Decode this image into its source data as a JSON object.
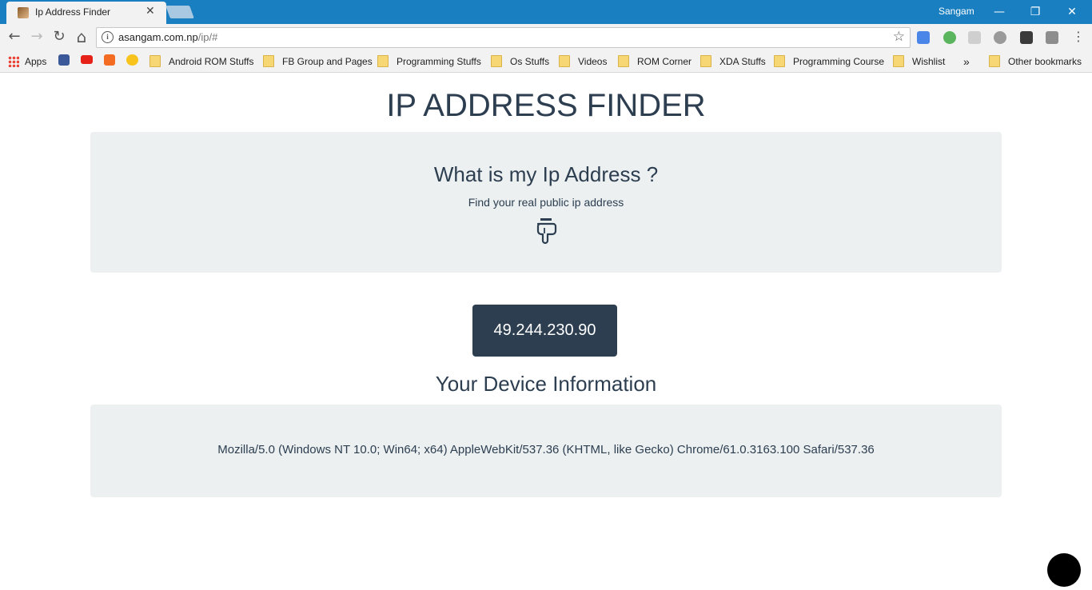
{
  "browser": {
    "tab_title": "Ip Address Finder",
    "tab_close": "✕",
    "profile_name": "Sangam",
    "window_controls": {
      "minimize": "—",
      "restore": "❐",
      "close": "✕"
    },
    "nav": {
      "back": "←",
      "forward": "→",
      "reload": "↻",
      "home": "⌂"
    },
    "url_host": "asangam.com.np",
    "url_path": "/ip/#",
    "bookmark_star": "☆",
    "bookmarks": {
      "apps": "Apps",
      "items": [
        "Android ROM Stuffs",
        "FB Group and Pages",
        "Programming Stuffs",
        "Os Stuffs",
        "Videos",
        "ROM Corner",
        "XDA Stuffs",
        "Programming Course",
        "Wishlist"
      ],
      "overflow": "»",
      "other": "Other bookmarks"
    }
  },
  "page": {
    "heading": "IP ADDRESS FINDER",
    "hero": {
      "title": "What is my Ip Address ?",
      "subtitle": "Find your real public ip address",
      "icon": "hand-pointing-down-icon"
    },
    "ip_address": "49.244.230.90",
    "device_heading": "Your Device Information",
    "user_agent": "Mozilla/5.0 (Windows NT 10.0; Win64; x64) AppleWebKit/537.36 (KHTML, like Gecko) Chrome/61.0.3163.100 Safari/537.36"
  },
  "colors": {
    "primary": "#2c3e50",
    "panel_bg": "#ecf0f1",
    "titlebar": "#1a7fc0"
  }
}
